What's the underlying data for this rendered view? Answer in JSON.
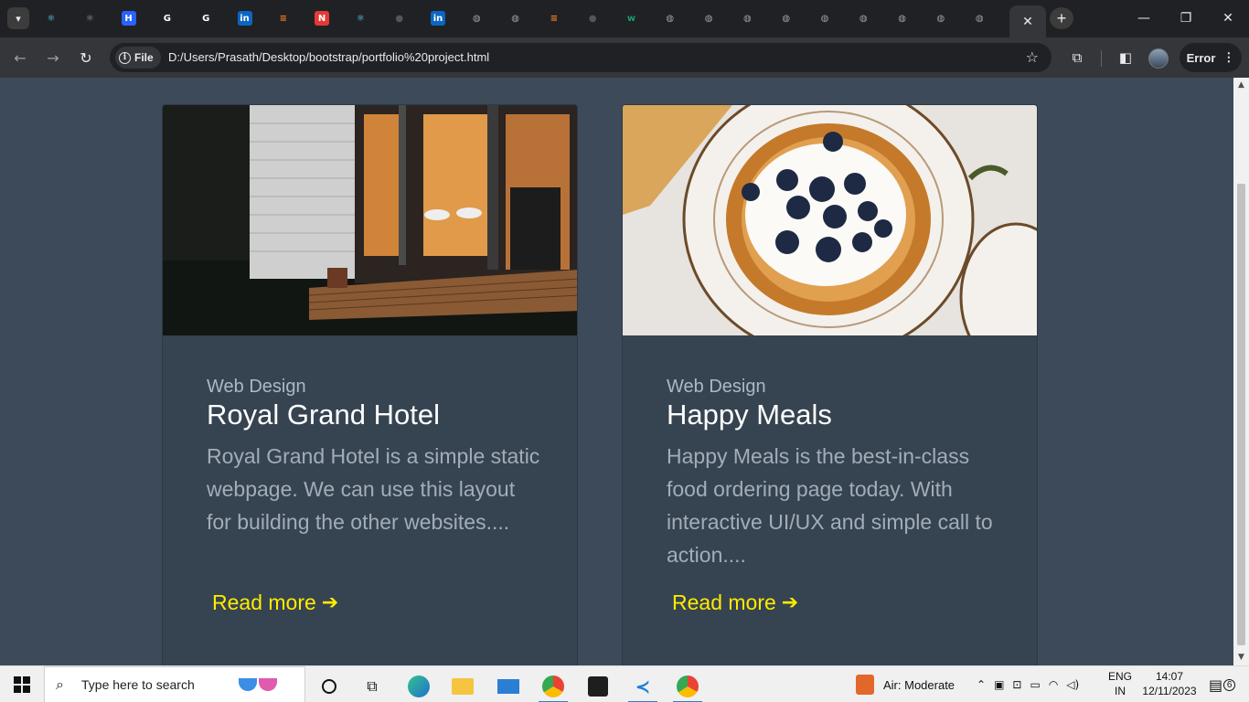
{
  "browser": {
    "tabs": [
      {
        "icon": "react-icon",
        "color": "#61dafb",
        "glyph": "⚛"
      },
      {
        "icon": "react-icon",
        "color": "#9e9e9e",
        "glyph": "⚛"
      },
      {
        "icon": "hashnode-icon",
        "color": "#2962ff",
        "glyph": "H"
      },
      {
        "icon": "google-icon",
        "color": "#ffffff",
        "glyph": "G"
      },
      {
        "icon": "google-icon",
        "color": "#ffffff",
        "glyph": "G"
      },
      {
        "icon": "linkedin-icon",
        "color": "#0a66c2",
        "glyph": "in"
      },
      {
        "icon": "stackoverflow-icon",
        "color": "#f48024",
        "glyph": "≡"
      },
      {
        "icon": "notion-icon",
        "color": "#e53935",
        "glyph": "N"
      },
      {
        "icon": "react-icon",
        "color": "#61dafb",
        "glyph": "⚛"
      },
      {
        "icon": "github-icon",
        "color": "#555555",
        "glyph": "●"
      },
      {
        "icon": "linkedin-icon",
        "color": "#0a66c2",
        "glyph": "in"
      },
      {
        "icon": "globe-icon",
        "color": "#9aa0a6",
        "glyph": "◍"
      },
      {
        "icon": "globe-icon",
        "color": "#9aa0a6",
        "glyph": "◍"
      },
      {
        "icon": "stackoverflow-icon",
        "color": "#f48024",
        "glyph": "≡"
      },
      {
        "icon": "github-icon",
        "color": "#555555",
        "glyph": "●"
      },
      {
        "icon": "webflow-icon",
        "color": "#1d9b6c",
        "glyph": "w"
      },
      {
        "icon": "globe-icon",
        "color": "#9aa0a6",
        "glyph": "◍"
      },
      {
        "icon": "globe-icon",
        "color": "#9aa0a6",
        "glyph": "◍"
      },
      {
        "icon": "globe-icon",
        "color": "#9aa0a6",
        "glyph": "◍"
      },
      {
        "icon": "globe-icon",
        "color": "#9aa0a6",
        "glyph": "◍"
      },
      {
        "icon": "globe-icon",
        "color": "#9aa0a6",
        "glyph": "◍"
      },
      {
        "icon": "globe-icon",
        "color": "#9aa0a6",
        "glyph": "◍"
      },
      {
        "icon": "globe-icon",
        "color": "#9aa0a6",
        "glyph": "◍"
      },
      {
        "icon": "globe-icon",
        "color": "#9aa0a6",
        "glyph": "◍"
      },
      {
        "icon": "globe-icon",
        "color": "#9aa0a6",
        "glyph": "◍"
      },
      {
        "icon": "close-icon",
        "color": "#e8eaed",
        "glyph": "✕",
        "active": true
      }
    ],
    "address": {
      "scheme_label": "File",
      "url": "D:/Users/Prasath/Desktop/bootstrap/portfolio%20project.html"
    },
    "error_label": "Error"
  },
  "page": {
    "background": "#3d4a59",
    "accent": "#ffeb00",
    "cards": [
      {
        "category": "Web Design",
        "title": "Royal Grand Hotel",
        "description": "Royal Grand Hotel is a simple static webpage. We can use this layout for building the other websites....",
        "link_label": "Read more",
        "image": "house-porch-night-image"
      },
      {
        "category": "Web Design",
        "title": "Happy Meals",
        "description": "Happy Meals is the best-in-class food ordering page today. With interactive UI/UX and simple call to action....",
        "link_label": "Read more",
        "image": "blueberry-pancake-plate-image"
      }
    ]
  },
  "taskbar": {
    "search_placeholder": "Type here to search",
    "weather": "Air: Moderate",
    "language_top": "ENG",
    "language_bottom": "IN",
    "time": "14:07",
    "date": "12/11/2023",
    "notification_count": "6"
  }
}
